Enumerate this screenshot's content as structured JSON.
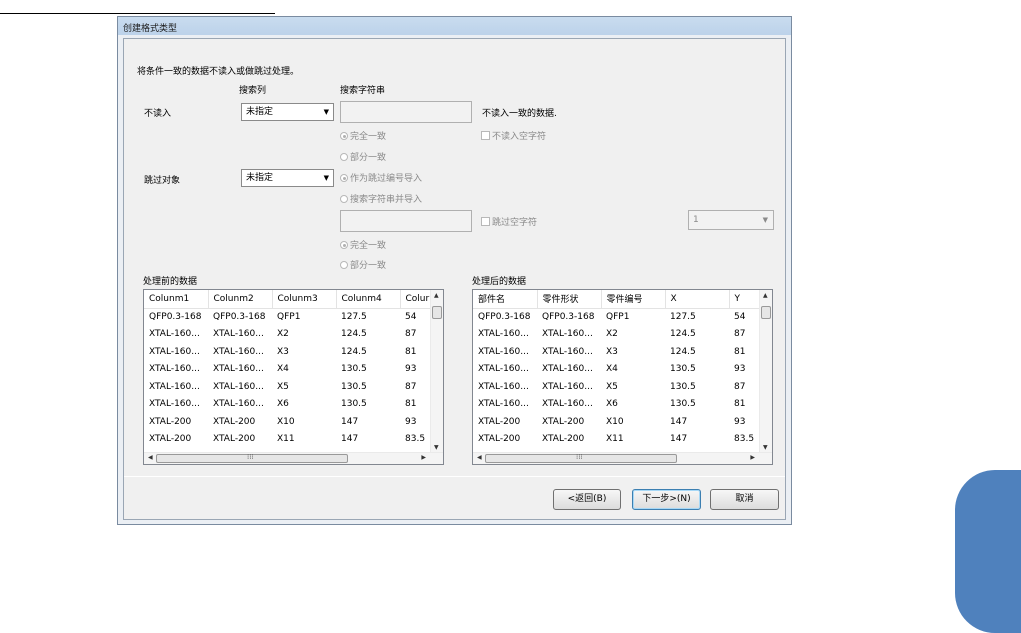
{
  "dialog": {
    "title": "创建格式类型",
    "instruction": "将条件一致的数据不读入或做跳过处理。",
    "col_header_search_column": "搜索列",
    "col_header_search_string": "搜索字符串",
    "no_read": {
      "label": "不读入",
      "dropdown_value": "未指定",
      "input_value": "",
      "description": "不读入一致的数据.",
      "radio_full_match": "完全一致",
      "radio_partial_match": "部分一致",
      "checkbox_empty": "不读入空字符"
    },
    "skip": {
      "label": "跳过对象",
      "dropdown_value": "未指定",
      "radio_import_as_skip": "作为跳过编号导入",
      "radio_import_search": "搜索字符串并导入",
      "input_value": "",
      "checkbox_empty": "跳过空字符",
      "number_value": "1",
      "radio_full_match": "完全一致",
      "radio_partial_match": "部分一致"
    },
    "before": {
      "label": "处理前的数据",
      "columns": [
        "Colunm1",
        "Colunm2",
        "Colunm3",
        "Colunm4",
        "Colur"
      ],
      "rows": [
        [
          "QFP0.3-168",
          "QFP0.3-168",
          "QFP1",
          "127.5",
          "54"
        ],
        [
          "XTAL-160...",
          "XTAL-160...",
          "X2",
          "124.5",
          "87"
        ],
        [
          "XTAL-160...",
          "XTAL-160...",
          "X3",
          "124.5",
          "81"
        ],
        [
          "XTAL-160...",
          "XTAL-160...",
          "X4",
          "130.5",
          "93"
        ],
        [
          "XTAL-160...",
          "XTAL-160...",
          "X5",
          "130.5",
          "87"
        ],
        [
          "XTAL-160...",
          "XTAL-160...",
          "X6",
          "130.5",
          "81"
        ],
        [
          "XTAL-200",
          "XTAL-200",
          "X10",
          "147",
          "93"
        ],
        [
          "XTAL-200",
          "XTAL-200",
          "X11",
          "147",
          "83.5"
        ]
      ]
    },
    "after": {
      "label": "处理后的数据",
      "columns": [
        "部件名",
        "零件形状",
        "零件编号",
        "X",
        "Y"
      ],
      "rows": [
        [
          "QFP0.3-168",
          "QFP0.3-168",
          "QFP1",
          "127.5",
          "54"
        ],
        [
          "XTAL-160...",
          "XTAL-160...",
          "X2",
          "124.5",
          "87"
        ],
        [
          "XTAL-160...",
          "XTAL-160...",
          "X3",
          "124.5",
          "81"
        ],
        [
          "XTAL-160...",
          "XTAL-160...",
          "X4",
          "130.5",
          "93"
        ],
        [
          "XTAL-160...",
          "XTAL-160...",
          "X5",
          "130.5",
          "87"
        ],
        [
          "XTAL-160...",
          "XTAL-160...",
          "X6",
          "130.5",
          "81"
        ],
        [
          "XTAL-200",
          "XTAL-200",
          "X10",
          "147",
          "93"
        ],
        [
          "XTAL-200",
          "XTAL-200",
          "X11",
          "147",
          "83.5"
        ]
      ]
    },
    "buttons": {
      "back": "<返回(B)",
      "next": "下一步>(N)",
      "cancel": "取消"
    }
  },
  "colors": {
    "side_tab": "#4f81bd",
    "title_bar": "#bcd2ea",
    "dialog_bg": "#f0f0f0"
  }
}
